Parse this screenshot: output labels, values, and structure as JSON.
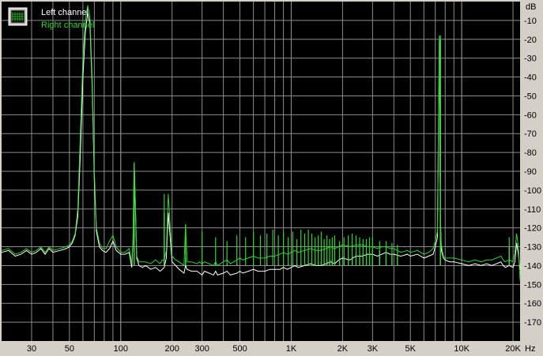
{
  "colors": {
    "background": "#000000",
    "grid": "#8c8c8c",
    "left_channel": "#ffffff",
    "right_channel": "#2bd62b",
    "frame": "#d4d0c8"
  },
  "legend": {
    "icon": "spectrum-chart-icon",
    "left_label": "Left channel",
    "right_label": "Right channel"
  },
  "chart_data": {
    "type": "line",
    "title": "",
    "x_unit": "Hz",
    "y_unit": "dB",
    "x_scale": "log",
    "xlim": [
      20,
      22000
    ],
    "ylim": [
      -180,
      0
    ],
    "grid": true,
    "legend_position": "top-left",
    "x_tick_labels": [
      {
        "v": 30,
        "label": "30"
      },
      {
        "v": 50,
        "label": "50"
      },
      {
        "v": 100,
        "label": "100"
      },
      {
        "v": 200,
        "label": "200"
      },
      {
        "v": 300,
        "label": "300"
      },
      {
        "v": 500,
        "label": "500"
      },
      {
        "v": 1000,
        "label": "1K"
      },
      {
        "v": 2000,
        "label": "2K"
      },
      {
        "v": 3000,
        "label": "3K"
      },
      {
        "v": 5000,
        "label": "5K"
      },
      {
        "v": 10000,
        "label": "10K"
      },
      {
        "v": 20000,
        "label": "20K"
      }
    ],
    "y_tick_labels": [
      {
        "v": -10,
        "label": "-10"
      },
      {
        "v": -20,
        "label": "-20"
      },
      {
        "v": -30,
        "label": "-30"
      },
      {
        "v": -40,
        "label": "-40"
      },
      {
        "v": -50,
        "label": "-50"
      },
      {
        "v": -60,
        "label": "-60"
      },
      {
        "v": -70,
        "label": "-70"
      },
      {
        "v": -80,
        "label": "-80"
      },
      {
        "v": -90,
        "label": "-90"
      },
      {
        "v": -100,
        "label": "-100"
      },
      {
        "v": -110,
        "label": "-110"
      },
      {
        "v": -120,
        "label": "-120"
      },
      {
        "v": -130,
        "label": "-130"
      },
      {
        "v": -140,
        "label": "-140"
      },
      {
        "v": -150,
        "label": "-150"
      },
      {
        "v": -160,
        "label": "-160"
      },
      {
        "v": -170,
        "label": "-170"
      }
    ],
    "series": [
      {
        "name": "Left channel",
        "x": [
          20,
          22,
          24,
          26,
          28,
          30,
          32,
          34,
          36,
          38,
          40,
          44,
          48,
          50,
          52,
          54,
          56,
          58,
          60,
          62,
          64,
          66,
          68,
          70,
          72,
          75,
          78,
          82,
          86,
          90,
          94,
          100,
          106,
          112,
          116,
          118,
          120,
          122,
          124,
          128,
          134,
          140,
          150,
          160,
          170,
          175,
          180,
          185,
          190,
          200,
          210,
          220,
          235,
          240,
          245,
          260,
          280,
          290,
          300,
          310,
          330,
          350,
          360,
          370,
          400,
          420,
          440,
          480,
          500,
          520,
          560,
          600,
          640,
          700,
          750,
          800,
          860,
          900,
          950,
          1000,
          1050,
          1100,
          1200,
          1300,
          1400,
          1500,
          1600,
          1700,
          1800,
          1900,
          2000,
          2200,
          2400,
          2600,
          2800,
          3000,
          3200,
          3400,
          3600,
          3800,
          4000,
          4400,
          4800,
          5000,
          5500,
          6000,
          6400,
          6800,
          7000,
          7200,
          7400,
          7500,
          7600,
          7800,
          8000,
          8500,
          9000,
          10000,
          11000,
          12000,
          13000,
          14000,
          15000,
          16000,
          17000,
          17500,
          18000,
          19000,
          20000,
          20500,
          21000,
          21500,
          22000
        ],
        "values": [
          -133,
          -132,
          -135,
          -134,
          -132,
          -134,
          -133,
          -131,
          -134,
          -131,
          -133,
          -132,
          -131,
          -130,
          -128,
          -124,
          -114,
          -80,
          -40,
          -16,
          -6,
          -12,
          -45,
          -95,
          -122,
          -130,
          -132,
          -133,
          -131,
          -127,
          -132,
          -134,
          -134,
          -133,
          -141,
          -128,
          -86,
          -110,
          -136,
          -140,
          -141,
          -140,
          -142,
          -141,
          -143,
          -142,
          -141,
          -136,
          -112,
          -138,
          -140,
          -142,
          -144,
          -140,
          -142,
          -143,
          -143,
          -144,
          -145,
          -143,
          -144,
          -145,
          -143,
          -145,
          -144,
          -143,
          -145,
          -144,
          -143,
          -144,
          -143,
          -142,
          -143,
          -143,
          -142,
          -142,
          -142,
          -141,
          -142,
          -141,
          -140,
          -141,
          -140,
          -139,
          -140,
          -140,
          -139,
          -138,
          -139,
          -137,
          -136,
          -137,
          -135,
          -135,
          -134,
          -134,
          -135,
          -134,
          -133,
          -134,
          -134,
          -135,
          -134,
          -135,
          -134,
          -136,
          -135,
          -134,
          -130,
          -125,
          -20,
          -118,
          -132,
          -136,
          -137,
          -138,
          -138,
          -139,
          -140,
          -139,
          -140,
          -139,
          -140,
          -139,
          -138,
          -140,
          -141,
          -140,
          -141,
          -138,
          -128,
          -134,
          -142
        ]
      },
      {
        "name": "Right channel",
        "x": [
          20,
          22,
          24,
          26,
          28,
          30,
          32,
          34,
          36,
          38,
          40,
          44,
          48,
          50,
          52,
          54,
          56,
          58,
          60,
          62,
          64,
          66,
          68,
          70,
          72,
          75,
          78,
          82,
          86,
          90,
          94,
          100,
          106,
          112,
          116,
          118,
          120,
          122,
          124,
          128,
          134,
          140,
          150,
          160,
          170,
          175,
          180,
          185,
          190,
          200,
          210,
          220,
          235,
          240,
          245,
          260,
          280,
          290,
          300,
          310,
          330,
          350,
          360,
          370,
          400,
          420,
          440,
          480,
          500,
          520,
          560,
          600,
          640,
          700,
          750,
          800,
          860,
          900,
          950,
          1000,
          1050,
          1100,
          1200,
          1300,
          1400,
          1500,
          1600,
          1700,
          1800,
          1900,
          2000,
          2200,
          2400,
          2600,
          2800,
          3000,
          3200,
          3400,
          3600,
          3800,
          4000,
          4400,
          4800,
          5000,
          5500,
          6000,
          6400,
          6800,
          7000,
          7200,
          7400,
          7500,
          7600,
          7800,
          8000,
          8500,
          9000,
          10000,
          11000,
          12000,
          13000,
          14000,
          15000,
          16000,
          17000,
          17500,
          18000,
          19000,
          20000,
          20500,
          21000,
          21500,
          22000
        ],
        "values": [
          -132,
          -131,
          -134,
          -133,
          -131,
          -133,
          -132,
          -130,
          -133,
          -130,
          -132,
          -131,
          -130,
          -129,
          -127,
          -123,
          -110,
          -70,
          -30,
          -10,
          -2,
          -8,
          -40,
          -90,
          -120,
          -128,
          -131,
          -131,
          -127,
          -124,
          -130,
          -133,
          -133,
          -131,
          -139,
          -126,
          -85,
          -108,
          -135,
          -138,
          -138,
          -138,
          -139,
          -137,
          -139,
          -137,
          -137,
          -132,
          -102,
          -135,
          -137,
          -138,
          -140,
          -118,
          -138,
          -138,
          -139,
          -138,
          -139,
          -138,
          -139,
          -140,
          -138,
          -140,
          -138,
          -137,
          -139,
          -137,
          -136,
          -137,
          -136,
          -135,
          -136,
          -136,
          -135,
          -135,
          -134,
          -133,
          -134,
          -133,
          -132,
          -133,
          -132,
          -131,
          -132,
          -132,
          -131,
          -130,
          -131,
          -130,
          -129,
          -130,
          -129,
          -129,
          -130,
          -130,
          -131,
          -130,
          -130,
          -131,
          -131,
          -133,
          -132,
          -133,
          -132,
          -134,
          -133,
          -131,
          -127,
          -122,
          -18,
          -115,
          -129,
          -135,
          -136,
          -136,
          -136,
          -137,
          -138,
          -137,
          -138,
          -137,
          -137,
          -136,
          -135,
          -137,
          -138,
          -137,
          -138,
          -133,
          -123,
          -130,
          -148
        ]
      }
    ],
    "spikes": [
      {
        "x": 120,
        "values": [
          -90,
          -86
        ]
      },
      {
        "x": 180,
        "values": [
          -112,
          -102
        ]
      },
      {
        "x": 240,
        "values": [
          -136,
          -118
        ]
      },
      {
        "x": 300,
        "values": [
          -138,
          -122
        ]
      },
      {
        "x": 360,
        "values": [
          -138,
          -125
        ]
      },
      {
        "x": 420,
        "values": [
          -139,
          -127
        ]
      },
      {
        "x": 480,
        "values": [
          -139,
          -124
        ]
      },
      {
        "x": 540,
        "values": [
          -140,
          -125
        ]
      },
      {
        "x": 600,
        "values": [
          -139,
          -122
        ]
      },
      {
        "x": 660,
        "values": [
          -140,
          -124
        ]
      },
      {
        "x": 720,
        "values": [
          -139,
          -123
        ]
      },
      {
        "x": 780,
        "values": [
          -140,
          -121
        ]
      },
      {
        "x": 840,
        "values": [
          -139,
          -124
        ]
      },
      {
        "x": 900,
        "values": [
          -139,
          -122
        ]
      },
      {
        "x": 960,
        "values": [
          -139,
          -125
        ]
      },
      {
        "x": 1020,
        "values": [
          -139,
          -122
        ]
      },
      {
        "x": 1080,
        "values": [
          -139,
          -126
        ]
      },
      {
        "x": 1140,
        "values": [
          -139,
          -121
        ]
      },
      {
        "x": 1200,
        "values": [
          -139,
          -123
        ]
      },
      {
        "x": 1260,
        "values": [
          -139,
          -121
        ]
      },
      {
        "x": 1320,
        "values": [
          -138,
          -123
        ]
      },
      {
        "x": 1380,
        "values": [
          -138,
          -125
        ]
      },
      {
        "x": 1440,
        "values": [
          -138,
          -124
        ]
      },
      {
        "x": 1500,
        "values": [
          -138,
          -122
        ]
      },
      {
        "x": 1560,
        "values": [
          -138,
          -126
        ]
      },
      {
        "x": 1620,
        "values": [
          -137,
          -124
        ]
      },
      {
        "x": 1680,
        "values": [
          -137,
          -126
        ]
      },
      {
        "x": 1740,
        "values": [
          -137,
          -125
        ]
      },
      {
        "x": 1800,
        "values": [
          -137,
          -124
        ]
      },
      {
        "x": 1920,
        "values": [
          -136,
          -127
        ]
      },
      {
        "x": 2040,
        "values": [
          -135,
          -125
        ]
      },
      {
        "x": 2160,
        "values": [
          -135,
          -124
        ]
      },
      {
        "x": 2280,
        "values": [
          -135,
          -123
        ]
      },
      {
        "x": 2400,
        "values": [
          -134,
          -124
        ]
      },
      {
        "x": 2520,
        "values": [
          -134,
          -125
        ]
      },
      {
        "x": 2640,
        "values": [
          -133,
          -126
        ]
      },
      {
        "x": 2760,
        "values": [
          -133,
          -126
        ]
      },
      {
        "x": 2880,
        "values": [
          -133,
          -125
        ]
      },
      {
        "x": 3000,
        "values": [
          -132,
          -125
        ]
      },
      {
        "x": 3300,
        "values": [
          -132,
          -127
        ]
      },
      {
        "x": 3600,
        "values": [
          -133,
          -127
        ]
      },
      {
        "x": 3900,
        "values": [
          -134,
          -128
        ]
      },
      {
        "x": 4200,
        "values": [
          -134,
          -129
        ]
      },
      {
        "x": 7500,
        "values": [
          -20,
          -18
        ]
      },
      {
        "x": 19000,
        "values": [
          -130,
          -125
        ]
      }
    ]
  }
}
